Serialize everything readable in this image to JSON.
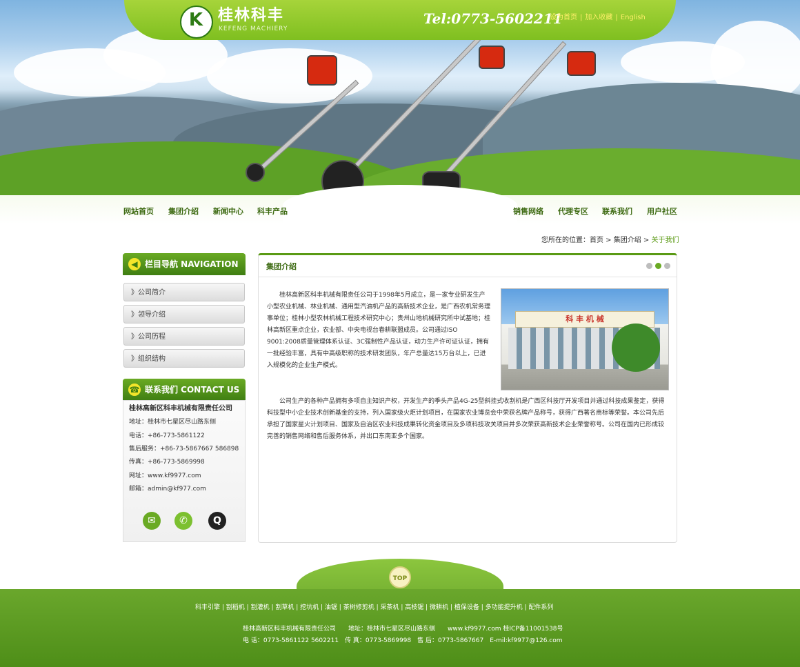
{
  "header": {
    "logo_cn": "桂林科丰",
    "logo_en": "KEFENG MACHIERY",
    "tel": "Tel:0773-5602211",
    "top_links": [
      "设为首页",
      "加入收藏",
      "English"
    ]
  },
  "nav": {
    "left": [
      "网站首页",
      "集团介绍",
      "新闻中心",
      "科丰产品"
    ],
    "right": [
      "销售网络",
      "代理专区",
      "联系我们",
      "用户社区"
    ]
  },
  "breadcrumb": {
    "prefix": "您所在的位置：",
    "items": [
      "首页",
      "集团介绍",
      "关于我们"
    ],
    "sep": " > "
  },
  "sidebar": {
    "nav_title": "栏目导航 NAVIGATION",
    "items": [
      "》公司简介",
      "》领导介绍",
      "》公司历程",
      "》组织结构"
    ],
    "contact_title": "联系我们 CONTACT US",
    "company": "桂林高新区科丰机械有限责任公司",
    "lines": [
      "地址：桂林市七星区尽山路东侧",
      "电话：+86-773-5861122",
      "售后服务：+86-73-5867667  586898",
      "传真：+86-773-5869998",
      "网址：www.kf9977.com",
      "邮箱：admin@kf977.com"
    ],
    "icons": [
      "email-icon",
      "wechat-icon",
      "qq-icon"
    ]
  },
  "main": {
    "title": "集团介绍",
    "para1": "桂林高新区科丰机械有限责任公司于1998年5月成立，是一家专业研发生产小型农业机械、林业机械、通用型汽油机产品的高新技术企业，是广西农机常务理事单位；桂林小型农林机械工程技术研究中心；贵州山地机械研究所中试基地；桂林高新区重点企业，农业部、中央电视台春耕联盟成员。公司通过ISO　9001:2008质量管理体系认证、3C强制性产品认证，动力生产许可证认证，拥有一批经验丰富，具有中高级职称的技术研发团队，年产总量达15万台以上，已进入规模化的企业生产模式。",
    "para2": "公司生产的各种产品拥有多项自主知识产权，开发生产的季头产品4G-25型斜挂式收割机是广西区科技厅开发项目并通过科技成果鉴定，获得科技型中小企业技术创新基金的支持，列入国家级火炬计划项目，在国家农业博览会中荣获名牌产品称号，获得广西著名商标等荣誉。本公司先后承担了国家星火计划项目、国家及自治区农业科技成果转化资金项目及多项科技攻关项目并多次荣获高新技术企业荣誉称号。公司在国内已形成较完善的销售网络和售后服务体系，并出口东南亚多个国家。",
    "photo_sign": "科 丰 机 械"
  },
  "footer": {
    "top_label": "TOP",
    "links": [
      "科丰引擎",
      "割稻机",
      "割灌机",
      "割草机",
      "挖坑机",
      "油锯",
      "茶树修剪机",
      "采茶机",
      "高枝锯",
      "微耕机",
      "植保设备",
      "多功能提升机",
      "配件系列"
    ],
    "line1": "桂林高新区科丰机械有限责任公司　　地址：桂林市七星区尽山路东侧　　www.kf9977.com 桂ICP备11001538号",
    "line2": "电 话：0773-5861122 5602211　传 真：0773-5869998　售 后：0773-5867667　E-mil:kf9977@126.com"
  },
  "colors": {
    "brand_green": "#5a9a14",
    "accent_yellow": "#ffef6a"
  }
}
